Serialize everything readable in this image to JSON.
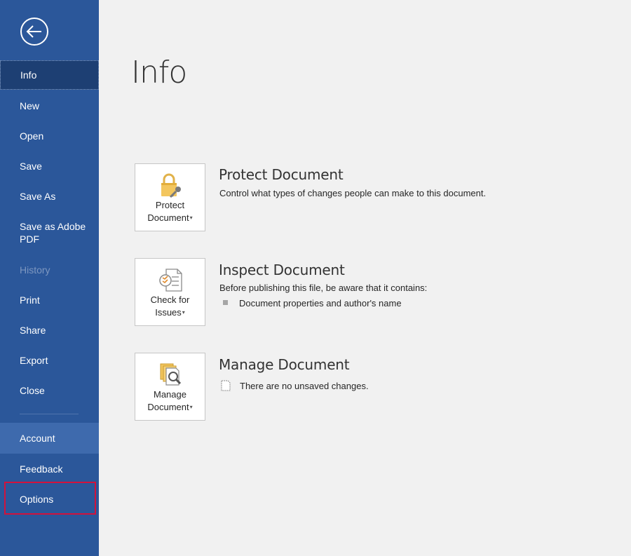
{
  "sidebar": {
    "back_icon": "back-arrow-icon",
    "items": [
      {
        "label": "Info"
      },
      {
        "label": "New"
      },
      {
        "label": "Open"
      },
      {
        "label": "Save"
      },
      {
        "label": "Save As"
      },
      {
        "label": "Save as Adobe PDF"
      },
      {
        "label": "History"
      },
      {
        "label": "Print"
      },
      {
        "label": "Share"
      },
      {
        "label": "Export"
      },
      {
        "label": "Close"
      },
      {
        "label": "Account"
      },
      {
        "label": "Feedback"
      },
      {
        "label": "Options"
      }
    ],
    "highlight_color": "#d2123c",
    "background_color": "#2b579a"
  },
  "main": {
    "title": "Info",
    "sections": [
      {
        "tile_line1": "Protect",
        "tile_line2": "Document",
        "icon": "lock-key-icon",
        "title": "Protect Document",
        "description": "Control what types of changes people can make to this document."
      },
      {
        "tile_line1": "Check for",
        "tile_line2": "Issues",
        "icon": "inspect-checklist-icon",
        "title": "Inspect Document",
        "description": "Before publishing this file, be aware that it contains:",
        "bullet": "Document properties and author's name"
      },
      {
        "tile_line1": "Manage",
        "tile_line2": "Document",
        "icon": "manage-document-icon",
        "title": "Manage Document",
        "description": "There are no unsaved changes."
      }
    ],
    "caret": "▾"
  }
}
